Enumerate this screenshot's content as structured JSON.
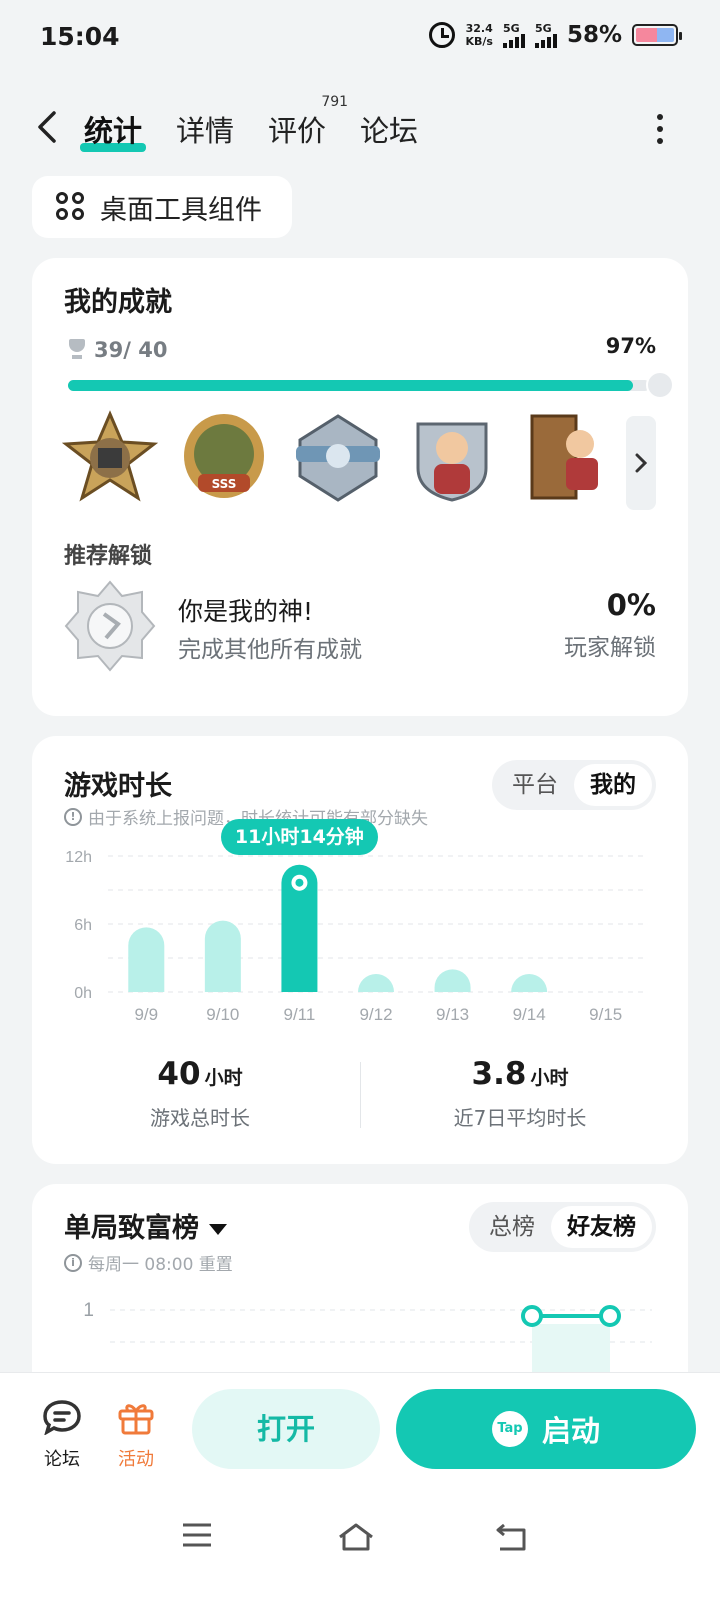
{
  "status": {
    "time": "15:04",
    "speed_value": "32.4",
    "speed_unit": "KB/s",
    "sim1": "5G",
    "sim2": "5G",
    "battery": "58%"
  },
  "header": {
    "tabs": [
      {
        "label": "统计",
        "active": true
      },
      {
        "label": "详情"
      },
      {
        "label": "评价",
        "badge": "791"
      },
      {
        "label": "论坛"
      }
    ]
  },
  "widget": {
    "label": "桌面工具组件"
  },
  "achievements": {
    "title": "我的成就",
    "count": "39/ 40",
    "percent": "97%",
    "progress": 0.97,
    "badge_text": "SSS",
    "recommend_title": "推荐解锁",
    "recommend": {
      "name": "你是我的神!",
      "desc": "完成其他所有成就",
      "percent": "0%",
      "percent_label": "玩家解锁"
    }
  },
  "playtime": {
    "title": "游戏时长",
    "toggle": [
      "平台",
      "我的"
    ],
    "note": "由于系统上报问题，时长统计可能有部分缺失",
    "tooltip": "11小时14分钟",
    "total_value": "40",
    "total_unit": "小时",
    "total_label": "游戏总时长",
    "avg_value": "3.8",
    "avg_unit": "小时",
    "avg_label": "近7日平均时长"
  },
  "chart_data": {
    "type": "bar",
    "categories": [
      "9/9",
      "9/10",
      "9/11",
      "9/12",
      "9/13",
      "9/14",
      "9/15"
    ],
    "values": [
      5.7,
      6.3,
      11.23,
      0.6,
      2.0,
      1.4,
      0
    ],
    "highlight_index": 2,
    "yticks": [
      "0h",
      "6h",
      "12h"
    ],
    "ylim": [
      0,
      12
    ],
    "colors": {
      "bar": "#b8f0e9",
      "highlight": "#14c8b3"
    }
  },
  "leaderboard": {
    "title": "单局致富榜",
    "note": "每周一 08:00 重置",
    "toggle": [
      "总榜",
      "好友榜"
    ],
    "ytick": "1"
  },
  "bottom": {
    "forum_label": "论坛",
    "activity_label": "活动",
    "open_label": "打开",
    "start_label": "启动",
    "tap_label": "Tap"
  },
  "colors": {
    "accent": "#14c8b3",
    "activity": "#f07a3a"
  }
}
